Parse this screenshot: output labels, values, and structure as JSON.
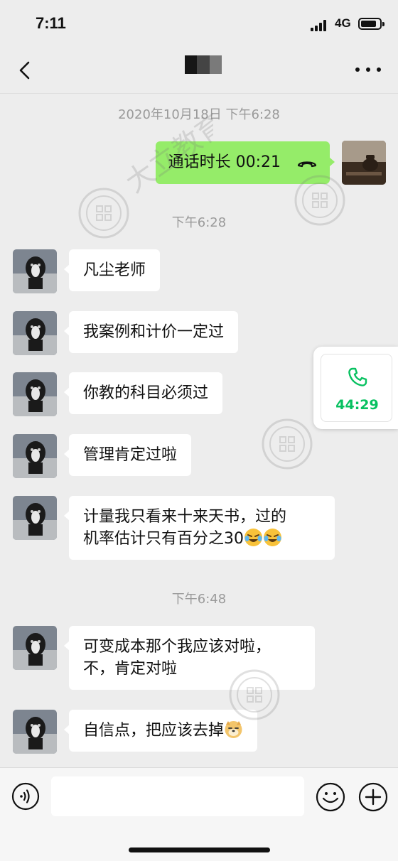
{
  "status": {
    "time": "7:11",
    "network": "4G"
  },
  "header": {
    "back_icon": "chevron-left-icon",
    "more_icon": "more-dots-icon"
  },
  "chat": {
    "timestamps": [
      "2020年10月18日 下午6:28",
      "下午6:28",
      "下午6:48"
    ],
    "call": {
      "text": "通话时长 00:21",
      "icon": "hangup-phone-icon"
    },
    "messages": [
      {
        "from": "contact",
        "lines": [
          "凡尘老师"
        ]
      },
      {
        "from": "contact",
        "lines": [
          "我案例和计价一定过"
        ]
      },
      {
        "from": "contact",
        "lines": [
          "你教的科目必须过"
        ]
      },
      {
        "from": "contact",
        "lines": [
          "管理肯定过啦"
        ]
      },
      {
        "from": "contact",
        "lines": [
          "计量我只看来十来天书，过的",
          "机率估计只有百分之30"
        ],
        "emojis": [
          "crying-laughing-emoji",
          "crying-laughing-emoji"
        ]
      },
      {
        "from": "contact",
        "lines": [
          "可变成本那个我应该对啦，",
          "不，肯定对啦"
        ]
      },
      {
        "from": "contact",
        "lines": [
          "自信点，把应该去掉"
        ],
        "emojis": [
          "doge-emoji"
        ]
      }
    ]
  },
  "floating_call": {
    "duration": "44:29",
    "icon": "phone-icon",
    "accent": "#07c160"
  },
  "watermark": {
    "text": "大立教育",
    "sub": "DALI EDUCATION"
  },
  "input_bar": {
    "voice_icon": "voice-icon",
    "placeholder": "",
    "emoji_icon": "smiley-icon",
    "plus_icon": "plus-icon"
  },
  "colors": {
    "background": "#ededed",
    "self_bubble": "#95ec69",
    "contact_bubble": "#ffffff",
    "timestamp": "#9a9a9a"
  }
}
